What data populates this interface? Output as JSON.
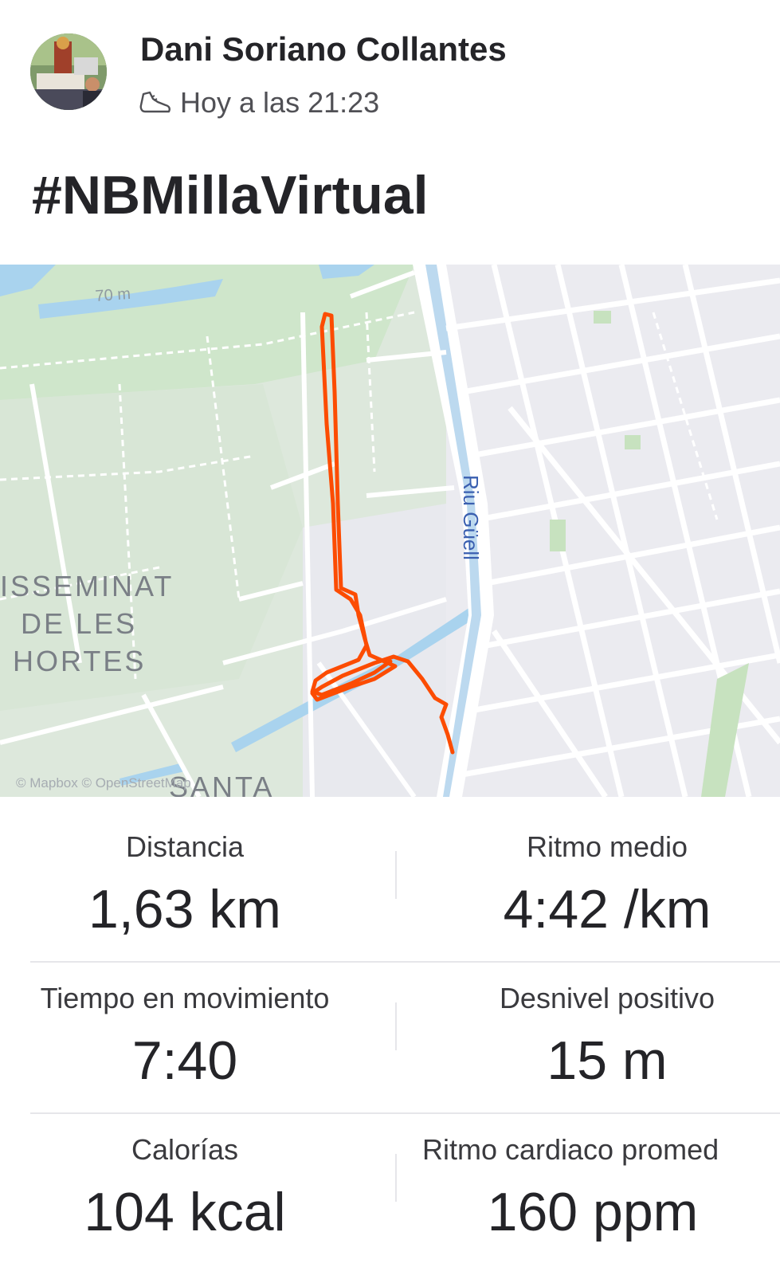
{
  "athlete": {
    "name": "Dani Soriano Collantes",
    "timestamp": "Hoy a las 21:23",
    "activity_icon": "shoe-icon"
  },
  "activity": {
    "title": "#NBMillaVirtual"
  },
  "map": {
    "elevation_label": "70 m",
    "river_label": "Riu Güell",
    "area_label_1": "ISSEMINAT",
    "area_label_2": "DE LES",
    "area_label_3": "HORTES",
    "area_label_4": "SANTA",
    "attribution": "© Mapbox © OpenStreetMap",
    "route_color": "#fc4c02"
  },
  "stats": [
    {
      "label": "Distancia",
      "value": "1,63 km"
    },
    {
      "label": "Ritmo medio",
      "value": "4:42 /km"
    },
    {
      "label": "Tiempo en movimiento",
      "value": "7:40"
    },
    {
      "label": "Desnivel positivo",
      "value": "15 m"
    },
    {
      "label": "Calorías",
      "value": "104 kcal"
    },
    {
      "label": "Ritmo cardiaco promed",
      "value": "160 ppm"
    }
  ]
}
